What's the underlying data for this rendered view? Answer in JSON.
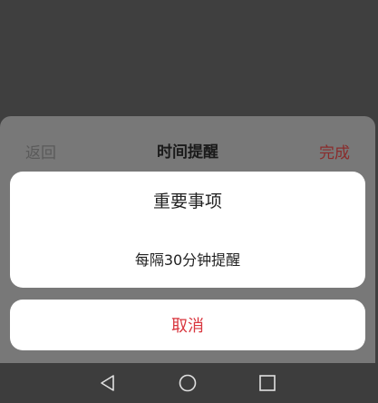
{
  "sheet": {
    "back_label": "返回",
    "title": "时间提醒",
    "done_label": "完成"
  },
  "action_sheet": {
    "title": "重要事项",
    "option": "每隔30分钟提醒",
    "cancel_label": "取消"
  },
  "navbar": {
    "icons": [
      "back-triangle-icon",
      "home-circle-icon",
      "recents-square-icon"
    ]
  },
  "colors": {
    "accent_red": "#d9363e",
    "done_red": "#8a2b2b",
    "overlay": "#787878"
  }
}
